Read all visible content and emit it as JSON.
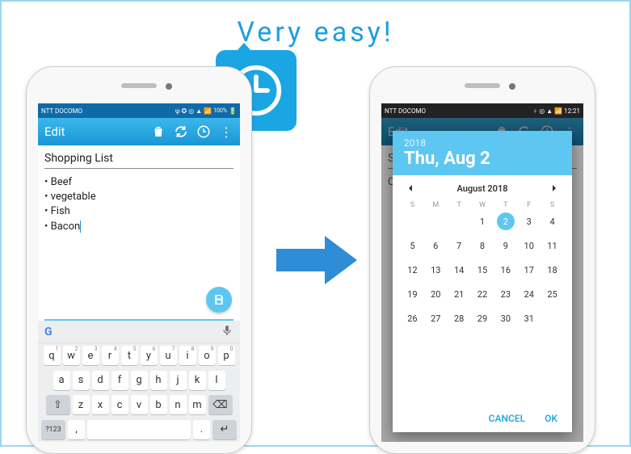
{
  "tagline": "Very easy!",
  "left": {
    "status": {
      "carrier": "NTT DOCOMO",
      "battery_text": "100%"
    },
    "appbar": {
      "title": "Edit",
      "icons": {
        "trash": "trash-icon",
        "refresh": "refresh-icon",
        "clock": "clock-icon",
        "more": "more-icon"
      }
    },
    "note": {
      "title": "Shopping List",
      "items": [
        "Beef",
        "vegetable",
        "Fish",
        "Bacon"
      ]
    },
    "keyboard": {
      "row1": [
        "q",
        "w",
        "e",
        "r",
        "t",
        "y",
        "u",
        "i",
        "o",
        "p"
      ],
      "row1_hints": [
        "1",
        "2",
        "3",
        "4",
        "5",
        "6",
        "7",
        "8",
        "9",
        "0"
      ],
      "row2": [
        "a",
        "s",
        "d",
        "f",
        "g",
        "h",
        "j",
        "k",
        "l"
      ],
      "row3_letters": [
        "z",
        "x",
        "c",
        "v",
        "b",
        "n",
        "m"
      ],
      "row3_shift": "⇧",
      "row3_back": "⌫",
      "row4_num": "?123",
      "row4_comma": ",",
      "row4_period": ".",
      "row4_enter": "↵"
    }
  },
  "right": {
    "status": {
      "carrier": "NTT DOCOMO",
      "time": "12:21"
    },
    "appbar": {
      "title": "Edit"
    },
    "note_partial_title": "Sho",
    "note_partial_body": "Co",
    "datepicker": {
      "year": "2018",
      "headline": "Thu, Aug 2",
      "month_label": "August 2018",
      "dow": [
        "S",
        "M",
        "T",
        "W",
        "T",
        "F",
        "S"
      ],
      "leading_blanks": 3,
      "days": 31,
      "selected": 2,
      "cancel": "CANCEL",
      "ok": "OK"
    }
  }
}
